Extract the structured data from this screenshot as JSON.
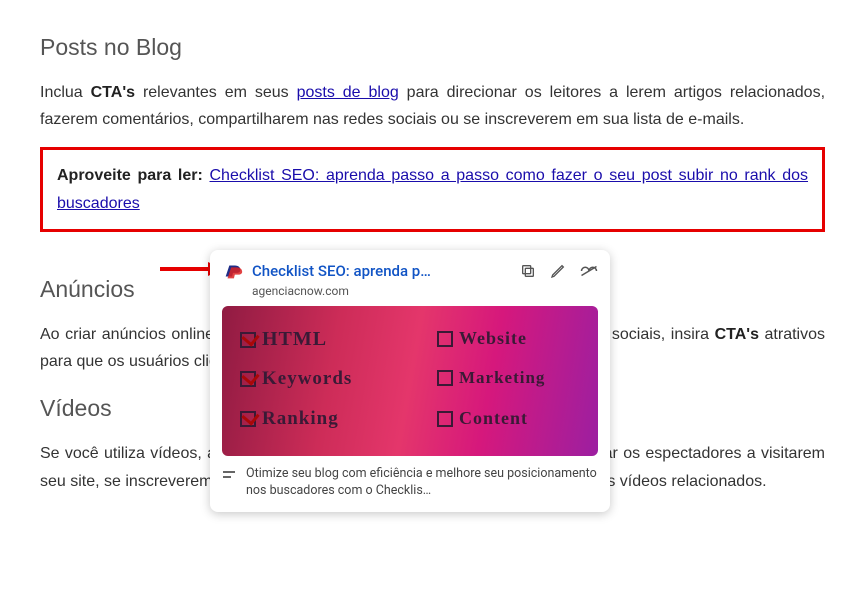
{
  "sections": {
    "posts": {
      "title": "Posts no Blog",
      "p_pre": "Inclua ",
      "p_bold": "CTA's",
      "p_mid": " relevantes em seus ",
      "p_link": "posts de blog",
      "p_rest": " para direcionar os leitores a lerem artigos relacionados, fazerem comentários, compartilharem nas redes sociais ou se inscreverem em sua lista de e-mails."
    },
    "highlight": {
      "lead": "Aproveite para ler: ",
      "link": "Checklist SEO: aprenda passo a passo como fazer o seu post subir no rank dos buscadores"
    },
    "anuncios": {
      "title": "Anúncios",
      "p_pre": "Ao criar anúncios online, seja em plataformas de mídia social, busca ou redes sociais, insira ",
      "p_bold": "CTA's",
      "p_rest": " atrativos para que os usuários cliquem no anúncio e realizarem uma ação específica."
    },
    "videos": {
      "title": "Vídeos",
      "p": "Se você utiliza vídeos, adicione chamadas para a ação no vídeo para direcionar os espectadores a visitarem seu site, se inscreverem no canal, realizarem uma compra ou assistirem a outros vídeos relacionados."
    }
  },
  "preview": {
    "title": "Checklist SEO: aprenda p…",
    "domain": "agenciacnow.com",
    "desc": "Otimize seu blog com eficiência e melhore seu posicionamento nos buscadores com o Checklis…",
    "thumb_words": {
      "html": "HTML",
      "keywords": "Keywords",
      "ranking": "Ranking",
      "website": "Website",
      "marketing": "Marketing",
      "content": "Content"
    }
  }
}
